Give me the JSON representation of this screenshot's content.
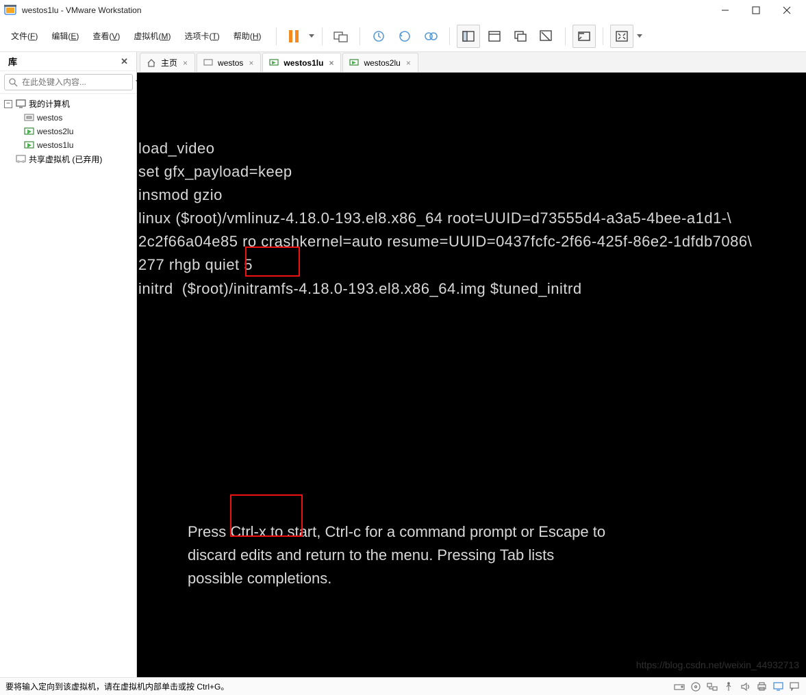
{
  "titlebar": {
    "title": "westos1lu - VMware Workstation"
  },
  "menubar": {
    "items": [
      {
        "label": "文件",
        "accel": "F"
      },
      {
        "label": "编辑",
        "accel": "E"
      },
      {
        "label": "查看",
        "accel": "V"
      },
      {
        "label": "虚拟机",
        "accel": "M"
      },
      {
        "label": "选项卡",
        "accel": "T"
      },
      {
        "label": "帮助",
        "accel": "H"
      }
    ]
  },
  "sidebar": {
    "header": "库",
    "search_placeholder": "在此处键入内容...",
    "nodes": {
      "my_computer": "我的计算机",
      "vm0": "westos",
      "vm1": "westos2lu",
      "vm2": "westos1lu",
      "shared": "共享虚拟机 (已弃用)"
    }
  },
  "tabs": {
    "home": "主页",
    "t0": "westos",
    "t1": "westos1lu",
    "t2": "westos2lu"
  },
  "console": {
    "lines": [
      "load_video",
      "set gfx_payload=keep",
      "insmod gzio",
      "linux ($root)/vmlinuz-4.18.0-193.el8.x86_64 root=UUID=d73555d4-a3a5-4bee-a1d1-\\",
      "2c2f66a04e85 ro crashkernel=auto resume=UUID=0437fcfc-2f66-425f-86e2-1dfdb7086\\",
      "277 rhgb quiet 5",
      "initrd  ($root)/initramfs-4.18.0-193.el8.x86_64.img $tuned_initrd"
    ],
    "prompt": [
      "Press Ctrl-x to start, Ctrl-c for a command prompt or Escape to",
      "discard edits and return to the menu. Pressing Tab lists",
      "possible completions."
    ]
  },
  "statusbar": {
    "text": "要将输入定向到该虚拟机，请在虚拟机内部单击或按 Ctrl+G。"
  },
  "watermark": "https://blog.csdn.net/weixin_44932713"
}
